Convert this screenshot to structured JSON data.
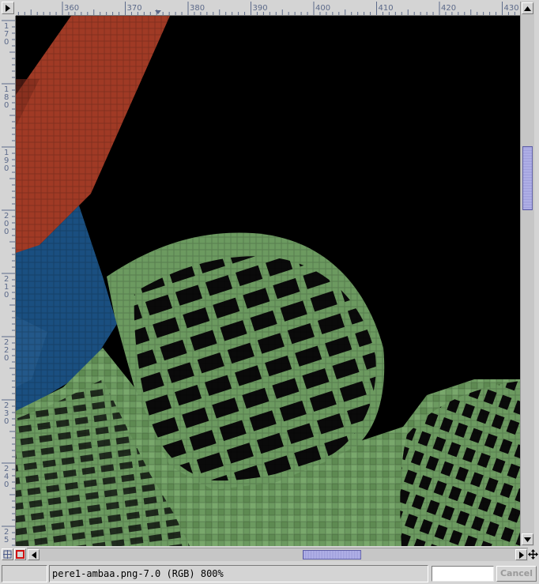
{
  "ruler_top": {
    "labels": [
      "360",
      "370",
      "380",
      "390",
      "400",
      "410",
      "420",
      "430"
    ]
  },
  "ruler_left": {
    "labels": [
      [
        "1",
        "7",
        "0"
      ],
      [
        "1",
        "8",
        "0"
      ],
      [
        "1",
        "9",
        "0"
      ],
      [
        "2",
        "0",
        "0"
      ],
      [
        "2",
        "1",
        "0"
      ],
      [
        "2",
        "2",
        "0"
      ],
      [
        "2",
        "3",
        "0"
      ],
      [
        "2",
        "4",
        "0"
      ],
      [
        "2",
        "5"
      ]
    ]
  },
  "canvas": {
    "background": "#000000",
    "colors": {
      "red": "#a03a25",
      "blue": "#1a4f80",
      "green": "#6c9a60",
      "dark_green": "#2a3a25"
    }
  },
  "statusbar": {
    "image_info": "pere1-ambaa.png-7.0 (RGB) 800%",
    "cancel_label": "Cancel"
  },
  "icons": {
    "menu": "arrow-right-icon",
    "navigate": "navigate-icon",
    "quickmask": "quickmask-icon",
    "move": "move-cross-icon"
  }
}
